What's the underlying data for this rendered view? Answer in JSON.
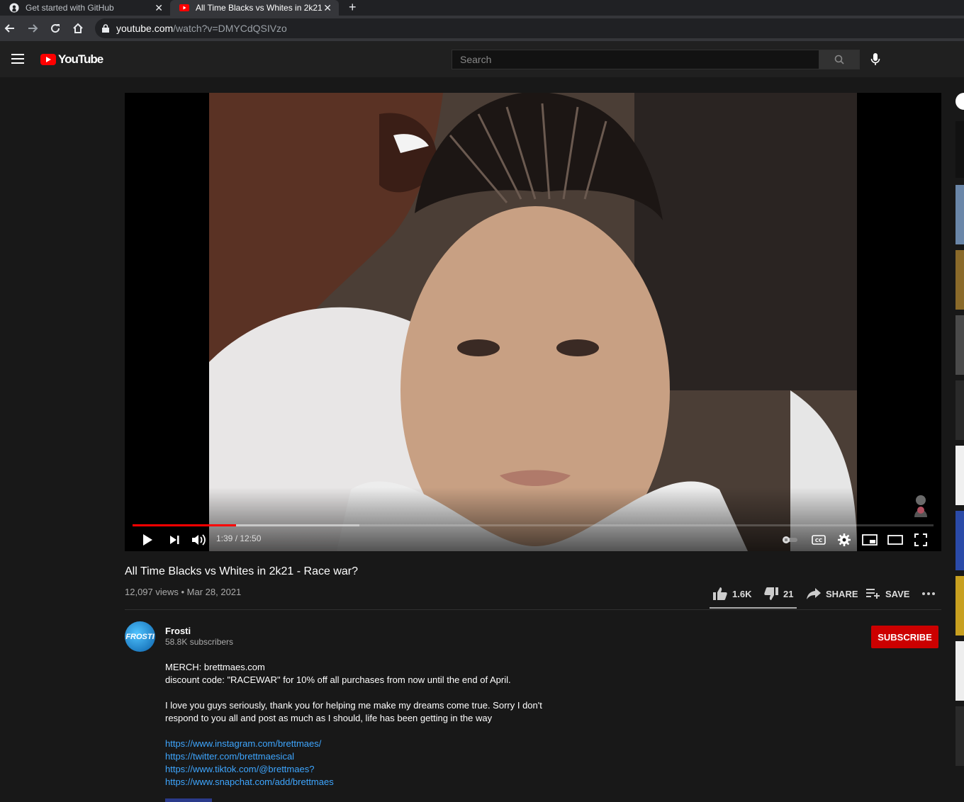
{
  "browser": {
    "tabs": [
      {
        "title": "Get started with GitHub",
        "icon": "github-icon",
        "active": false
      },
      {
        "title": "All Time Blacks vs Whites in 2k21",
        "icon": "youtube-favicon-icon",
        "active": true
      }
    ],
    "url_host": "youtube.com",
    "url_path": "/watch?v=DMYCdQSIVzo"
  },
  "header": {
    "logo_text": "YouTube",
    "search_placeholder": "Search"
  },
  "player": {
    "current_time": "1:39",
    "duration": "12:50",
    "time_display": "1:39 / 12:50",
    "progress_fraction": 0.129,
    "buffered_fraction": 0.283,
    "accent": "#ff0000"
  },
  "video": {
    "title": "All Time Blacks vs Whites in 2k21 - Race war?",
    "meta": "12,097 views • Mar 28, 2021",
    "likes": "1.6K",
    "dislikes": "21",
    "share_label": "SHARE",
    "save_label": "SAVE"
  },
  "channel": {
    "name": "Frosti",
    "avatar_text": "FROSTI",
    "subscribers": "58.8K subscribers",
    "subscribe_label": "SUBSCRIBE"
  },
  "description": {
    "lines": [
      "MERCH: brettmaes.com",
      "discount code: \"RACEWAR\" for 10% off all purchases from now until the end of April.",
      "I love you guys seriously, thank you for helping me make my dreams come true. Sorry I don't",
      "respond to you all and post as much as I should, life has been getting in the way"
    ],
    "links": [
      "https://www.instagram.com/brettmaes/",
      "https://twitter.com/brettmaesical",
      "https://www.tiktok.com/@brettmaes?",
      "https://www.snapchat.com/add/brettmaes"
    ]
  }
}
